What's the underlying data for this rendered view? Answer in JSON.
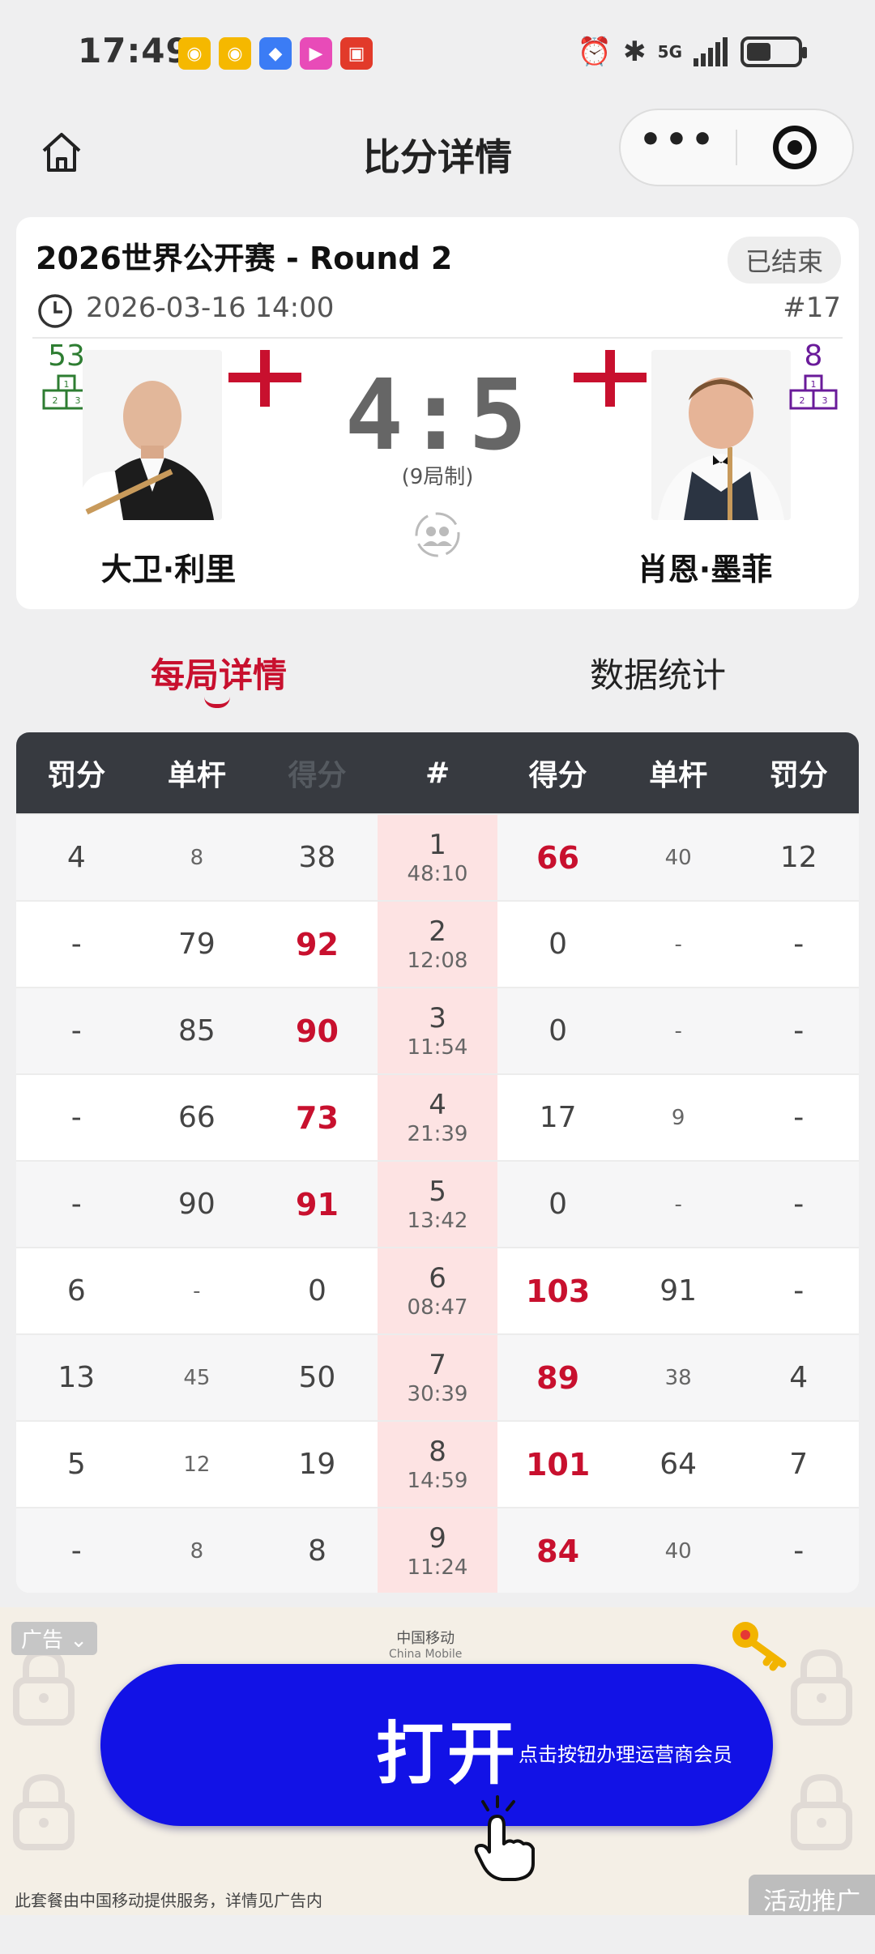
{
  "status_bar": {
    "time": "17:49",
    "network": "5G",
    "battery_level": 0.45
  },
  "nav": {
    "title": "比分详情",
    "more_label": "•••"
  },
  "match": {
    "title": "2026世界公开赛 - Round 2",
    "status": "已结束",
    "datetime": "2026-03-16 14:00",
    "number": "#17",
    "score": "4:5",
    "format": "(9局制)",
    "left_player": {
      "name": "大卫·利里",
      "rank": "53",
      "podium_labels": [
        "1",
        "2",
        "3"
      ]
    },
    "right_player": {
      "name": "肖恩·墨菲",
      "rank": "8",
      "podium_labels": [
        "1",
        "2",
        "3"
      ]
    }
  },
  "tabs": [
    {
      "label": "每局详情",
      "active": true
    },
    {
      "label": "数据统计",
      "active": false
    }
  ],
  "table": {
    "headers": [
      "罚分",
      "单杆",
      "得分",
      "#",
      "得分",
      "单杆",
      "罚分"
    ],
    "rows": [
      {
        "l_foul": "4",
        "l_break": "8",
        "l_score": "38",
        "frame": "1",
        "time": "48:10",
        "r_score": "66",
        "r_break": "40",
        "r_foul": "12",
        "winner": "right"
      },
      {
        "l_foul": "-",
        "l_break": "79",
        "l_score": "92",
        "frame": "2",
        "time": "12:08",
        "r_score": "0",
        "r_break": "-",
        "r_foul": "-",
        "winner": "left"
      },
      {
        "l_foul": "-",
        "l_break": "85",
        "l_score": "90",
        "frame": "3",
        "time": "11:54",
        "r_score": "0",
        "r_break": "-",
        "r_foul": "-",
        "winner": "left"
      },
      {
        "l_foul": "-",
        "l_break": "66",
        "l_score": "73",
        "frame": "4",
        "time": "21:39",
        "r_score": "17",
        "r_break": "9",
        "r_foul": "-",
        "winner": "left"
      },
      {
        "l_foul": "-",
        "l_break": "90",
        "l_score": "91",
        "frame": "5",
        "time": "13:42",
        "r_score": "0",
        "r_break": "-",
        "r_foul": "-",
        "winner": "left"
      },
      {
        "l_foul": "6",
        "l_break": "-",
        "l_score": "0",
        "frame": "6",
        "time": "08:47",
        "r_score": "103",
        "r_break": "91",
        "r_foul": "-",
        "winner": "right"
      },
      {
        "l_foul": "13",
        "l_break": "45",
        "l_score": "50",
        "frame": "7",
        "time": "30:39",
        "r_score": "89",
        "r_break": "38",
        "r_foul": "4",
        "winner": "right"
      },
      {
        "l_foul": "5",
        "l_break": "12",
        "l_score": "19",
        "frame": "8",
        "time": "14:59",
        "r_score": "101",
        "r_break": "64",
        "r_foul": "7",
        "winner": "right"
      },
      {
        "l_foul": "-",
        "l_break": "8",
        "l_score": "8",
        "frame": "9",
        "time": "11:24",
        "r_score": "84",
        "r_break": "40",
        "r_foul": "-",
        "winner": "right"
      }
    ]
  },
  "ad": {
    "label": "广告",
    "brand": "中国移动",
    "brand_en": "China Mobile",
    "button_label": "打开",
    "cta": "点击按钮办理运营商会员",
    "disclaimer": "此套餐由中国移动提供服务，详情见广告内",
    "promo": "活动推广"
  },
  "colors": {
    "accent": "#c8102e",
    "table_header": "#373a40",
    "frame_col": "#fde3e3",
    "ad_button": "#1212e6"
  }
}
